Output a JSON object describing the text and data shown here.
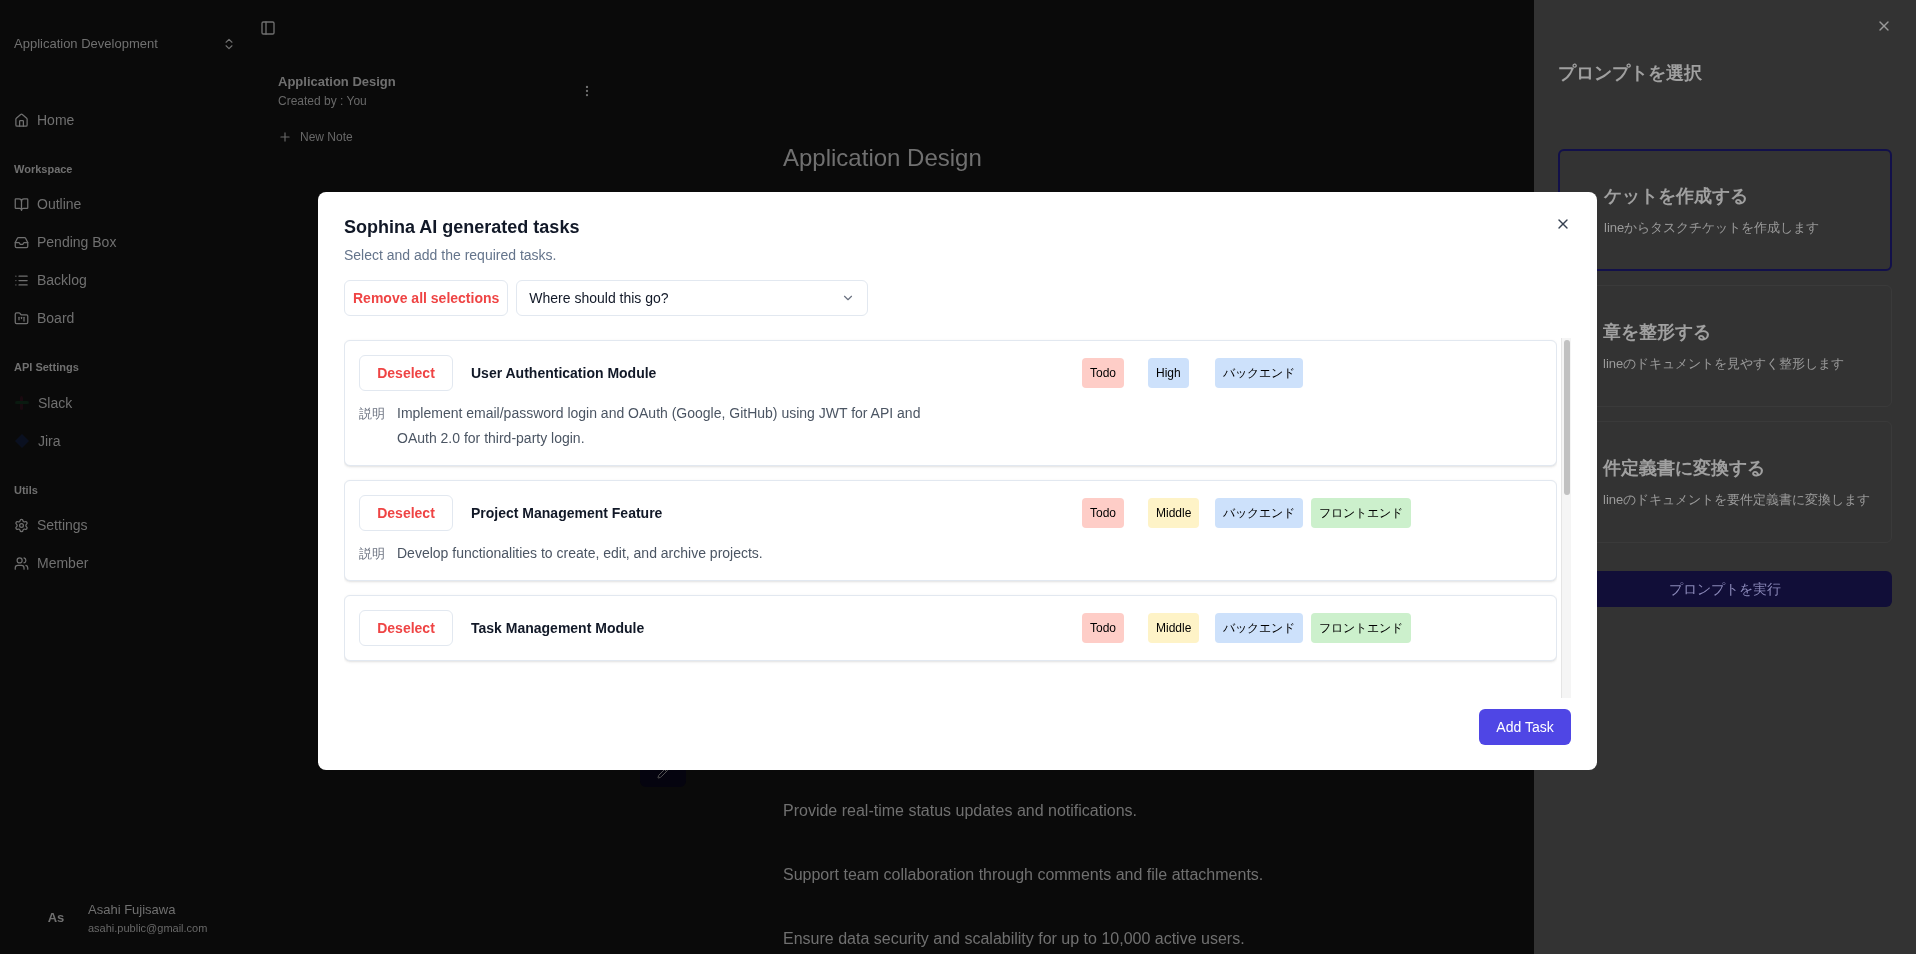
{
  "sidebar": {
    "workspace_select": "Application Development",
    "home": {
      "label": "Home"
    },
    "sections": [
      {
        "title": "Workspace",
        "items": [
          {
            "label": "Outline"
          },
          {
            "label": "Pending Box"
          },
          {
            "label": "Backlog"
          },
          {
            "label": "Board"
          }
        ]
      },
      {
        "title": "API Settings",
        "items": [
          {
            "label": "Slack"
          },
          {
            "label": "Jira"
          }
        ]
      },
      {
        "title": "Utils",
        "items": [
          {
            "label": "Settings"
          },
          {
            "label": "Member"
          }
        ]
      }
    ],
    "user": {
      "initials": "As",
      "name": "Asahi Fujisawa",
      "email": "asahi.public@gmail.com"
    }
  },
  "notes": {
    "items": [
      {
        "title": "Application Design",
        "meta": "Created by : You"
      }
    ],
    "new_note": "New Note"
  },
  "document": {
    "heading": "Application Design",
    "paragraphs": [
      "Provide real-time status updates and notifications.",
      "Support team collaboration through comments and file attachments.",
      "Ensure data security and scalability for up to 10,000 active users."
    ]
  },
  "prompt_panel": {
    "title": "プロンプトを選択",
    "options": [
      {
        "title": "ケットを作成する",
        "description": "lineからタスクチケットを作成します",
        "selected": true
      },
      {
        "title": "章を整形する",
        "description": "lineのドキュメントを見やすく整形します",
        "selected": false
      },
      {
        "title": "件定義書に変換する",
        "description": "lineのドキュメントを要件定義書に変換します",
        "selected": false
      }
    ],
    "run_button": "プロンプトを実行"
  },
  "modal": {
    "title": "Sophina AI generated tasks",
    "subtitle": "Select and add the required tasks.",
    "remove_all_button": "Remove all selections",
    "destination_select": {
      "placeholder": "Where should this go?"
    },
    "tasks": [
      {
        "button": "Deselect",
        "title": "User Authentication Module",
        "status": {
          "label": "Todo",
          "color": "#fecdc7"
        },
        "priority": {
          "label": "High",
          "color": "#cde1fb"
        },
        "categories": [
          {
            "label": "バックエンド",
            "color": "#cde1fb"
          }
        ],
        "description_label": "説明",
        "description": "Implement email/password login and OAuth (Google, GitHub) using JWT for API and OAuth 2.0 for third-party login."
      },
      {
        "button": "Deselect",
        "title": "Project Management Feature",
        "status": {
          "label": "Todo",
          "color": "#fecdc7"
        },
        "priority": {
          "label": "Middle",
          "color": "#fef3c7"
        },
        "categories": [
          {
            "label": "バックエンド",
            "color": "#cde1fb"
          },
          {
            "label": "フロントエンド",
            "color": "#ccf0cc"
          }
        ],
        "description_label": "説明",
        "description": "Develop functionalities to create, edit, and archive projects."
      },
      {
        "button": "Deselect",
        "title": "Task Management Module",
        "status": {
          "label": "Todo",
          "color": "#fecdc7"
        },
        "priority": {
          "label": "Middle",
          "color": "#fef3c7"
        },
        "categories": [
          {
            "label": "バックエンド",
            "color": "#cde1fb"
          },
          {
            "label": "フロントエンド",
            "color": "#ccf0cc"
          }
        ]
      }
    ],
    "add_button": "Add Task"
  }
}
